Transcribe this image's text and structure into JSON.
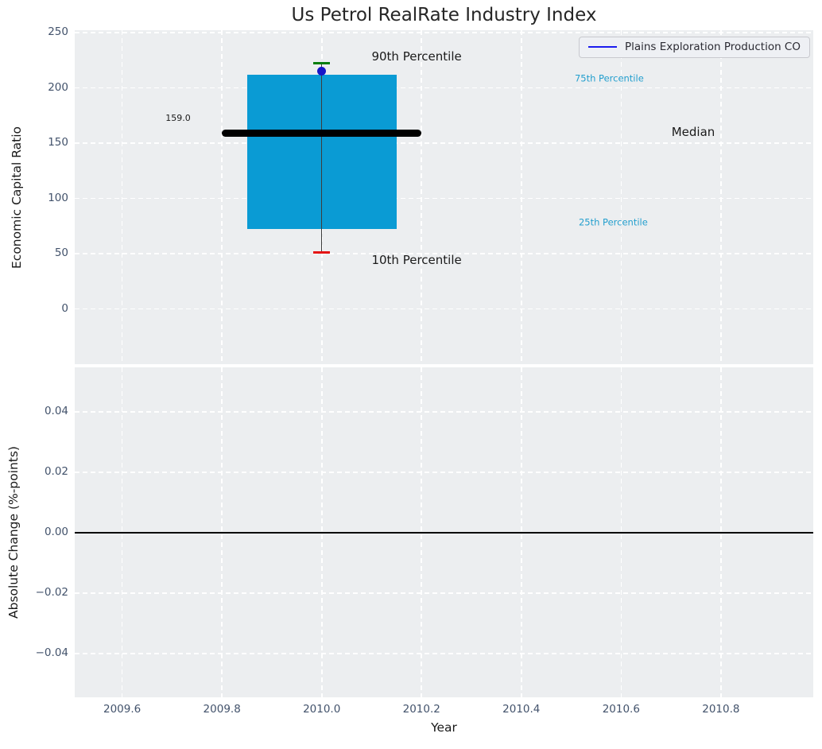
{
  "colors": {
    "figure_bg": "#ffffff",
    "plot_bg": "#eceef0",
    "grid": "#ffffff",
    "box_fill": "#0a9bd4",
    "median_line": "#000000",
    "whisker": "#3d3d3d",
    "cap_90th": "#077d0e",
    "cap_10th": "#e41414",
    "company_dot": "#1616c8",
    "legend_line": "#1b1bef",
    "zero_line": "#000000",
    "tick_label": "#42526b",
    "axis_label": "#1a1a1a",
    "title": "#262626",
    "percentile_text": "#249fce"
  },
  "chart_data": [
    {
      "type": "box",
      "title": "Us Petrol RealRate Industry Index",
      "ylabel": "Economic Capital Ratio",
      "xlim": [
        2009.505,
        2010.985
      ],
      "ylim": [
        -50,
        252
      ],
      "grid": true,
      "yticks": [
        {
          "v": 0,
          "label": "0"
        },
        {
          "v": 50,
          "label": "50"
        },
        {
          "v": 100,
          "label": "100"
        },
        {
          "v": 150,
          "label": "150"
        },
        {
          "v": 200,
          "label": "200"
        },
        {
          "v": 250,
          "label": "250"
        }
      ],
      "box": {
        "x": 2010.0,
        "p10": 51,
        "p25": 72,
        "median": 159,
        "p75": 212,
        "p90": 222,
        "box_halfwidth": 0.15,
        "median_halfwidth": 0.2,
        "cap_halfwidth": 0.017
      },
      "series": [
        {
          "name": "Plains Exploration Production CO",
          "x": [
            2010.0
          ],
          "y": [
            215
          ]
        }
      ],
      "legend": {
        "label": "Plains Exploration Production CO",
        "position": "upper right"
      },
      "median_value_label": "159.0",
      "annotations": [
        {
          "text": "90th Percentile",
          "x": 2010.1,
          "y": 228,
          "size": 15,
          "color": "#1a1a1a"
        },
        {
          "text": "75th Percentile",
          "x": 2010.507,
          "y": 208,
          "size": 11.5,
          "color": "#249fce"
        },
        {
          "text": "Median",
          "x": 2010.701,
          "y": 160,
          "size": 15,
          "color": "#1a1a1a"
        },
        {
          "text": "25th Percentile",
          "x": 2010.515,
          "y": 78,
          "size": 11.5,
          "color": "#249fce"
        },
        {
          "text": "10th Percentile",
          "x": 2010.1,
          "y": 44,
          "size": 15,
          "color": "#1a1a1a"
        },
        {
          "text": "159.0",
          "x": 2009.687,
          "y": 172.5,
          "size": 11,
          "color": "#1a1a1a"
        }
      ]
    },
    {
      "type": "line",
      "ylabel": "Absolute Change (%-points)",
      "xlabel": "Year",
      "xlim": [
        2009.505,
        2010.985
      ],
      "ylim": [
        -0.0545,
        0.0547
      ],
      "grid": true,
      "zero_line_y": 0.0,
      "xticks": [
        {
          "v": 2009.6,
          "label": "2009.6"
        },
        {
          "v": 2009.8,
          "label": "2009.8"
        },
        {
          "v": 2010.0,
          "label": "2010.0"
        },
        {
          "v": 2010.2,
          "label": "2010.2"
        },
        {
          "v": 2010.4,
          "label": "2010.4"
        },
        {
          "v": 2010.6,
          "label": "2010.6"
        },
        {
          "v": 2010.8,
          "label": "2010.8"
        }
      ],
      "yticks": [
        {
          "v": 0.04,
          "label": "0.04"
        },
        {
          "v": 0.02,
          "label": "0.02"
        },
        {
          "v": 0.0,
          "label": "0.00"
        },
        {
          "v": -0.02,
          "label": "−0.02"
        },
        {
          "v": -0.04,
          "label": "−0.04"
        }
      ],
      "series": []
    }
  ]
}
